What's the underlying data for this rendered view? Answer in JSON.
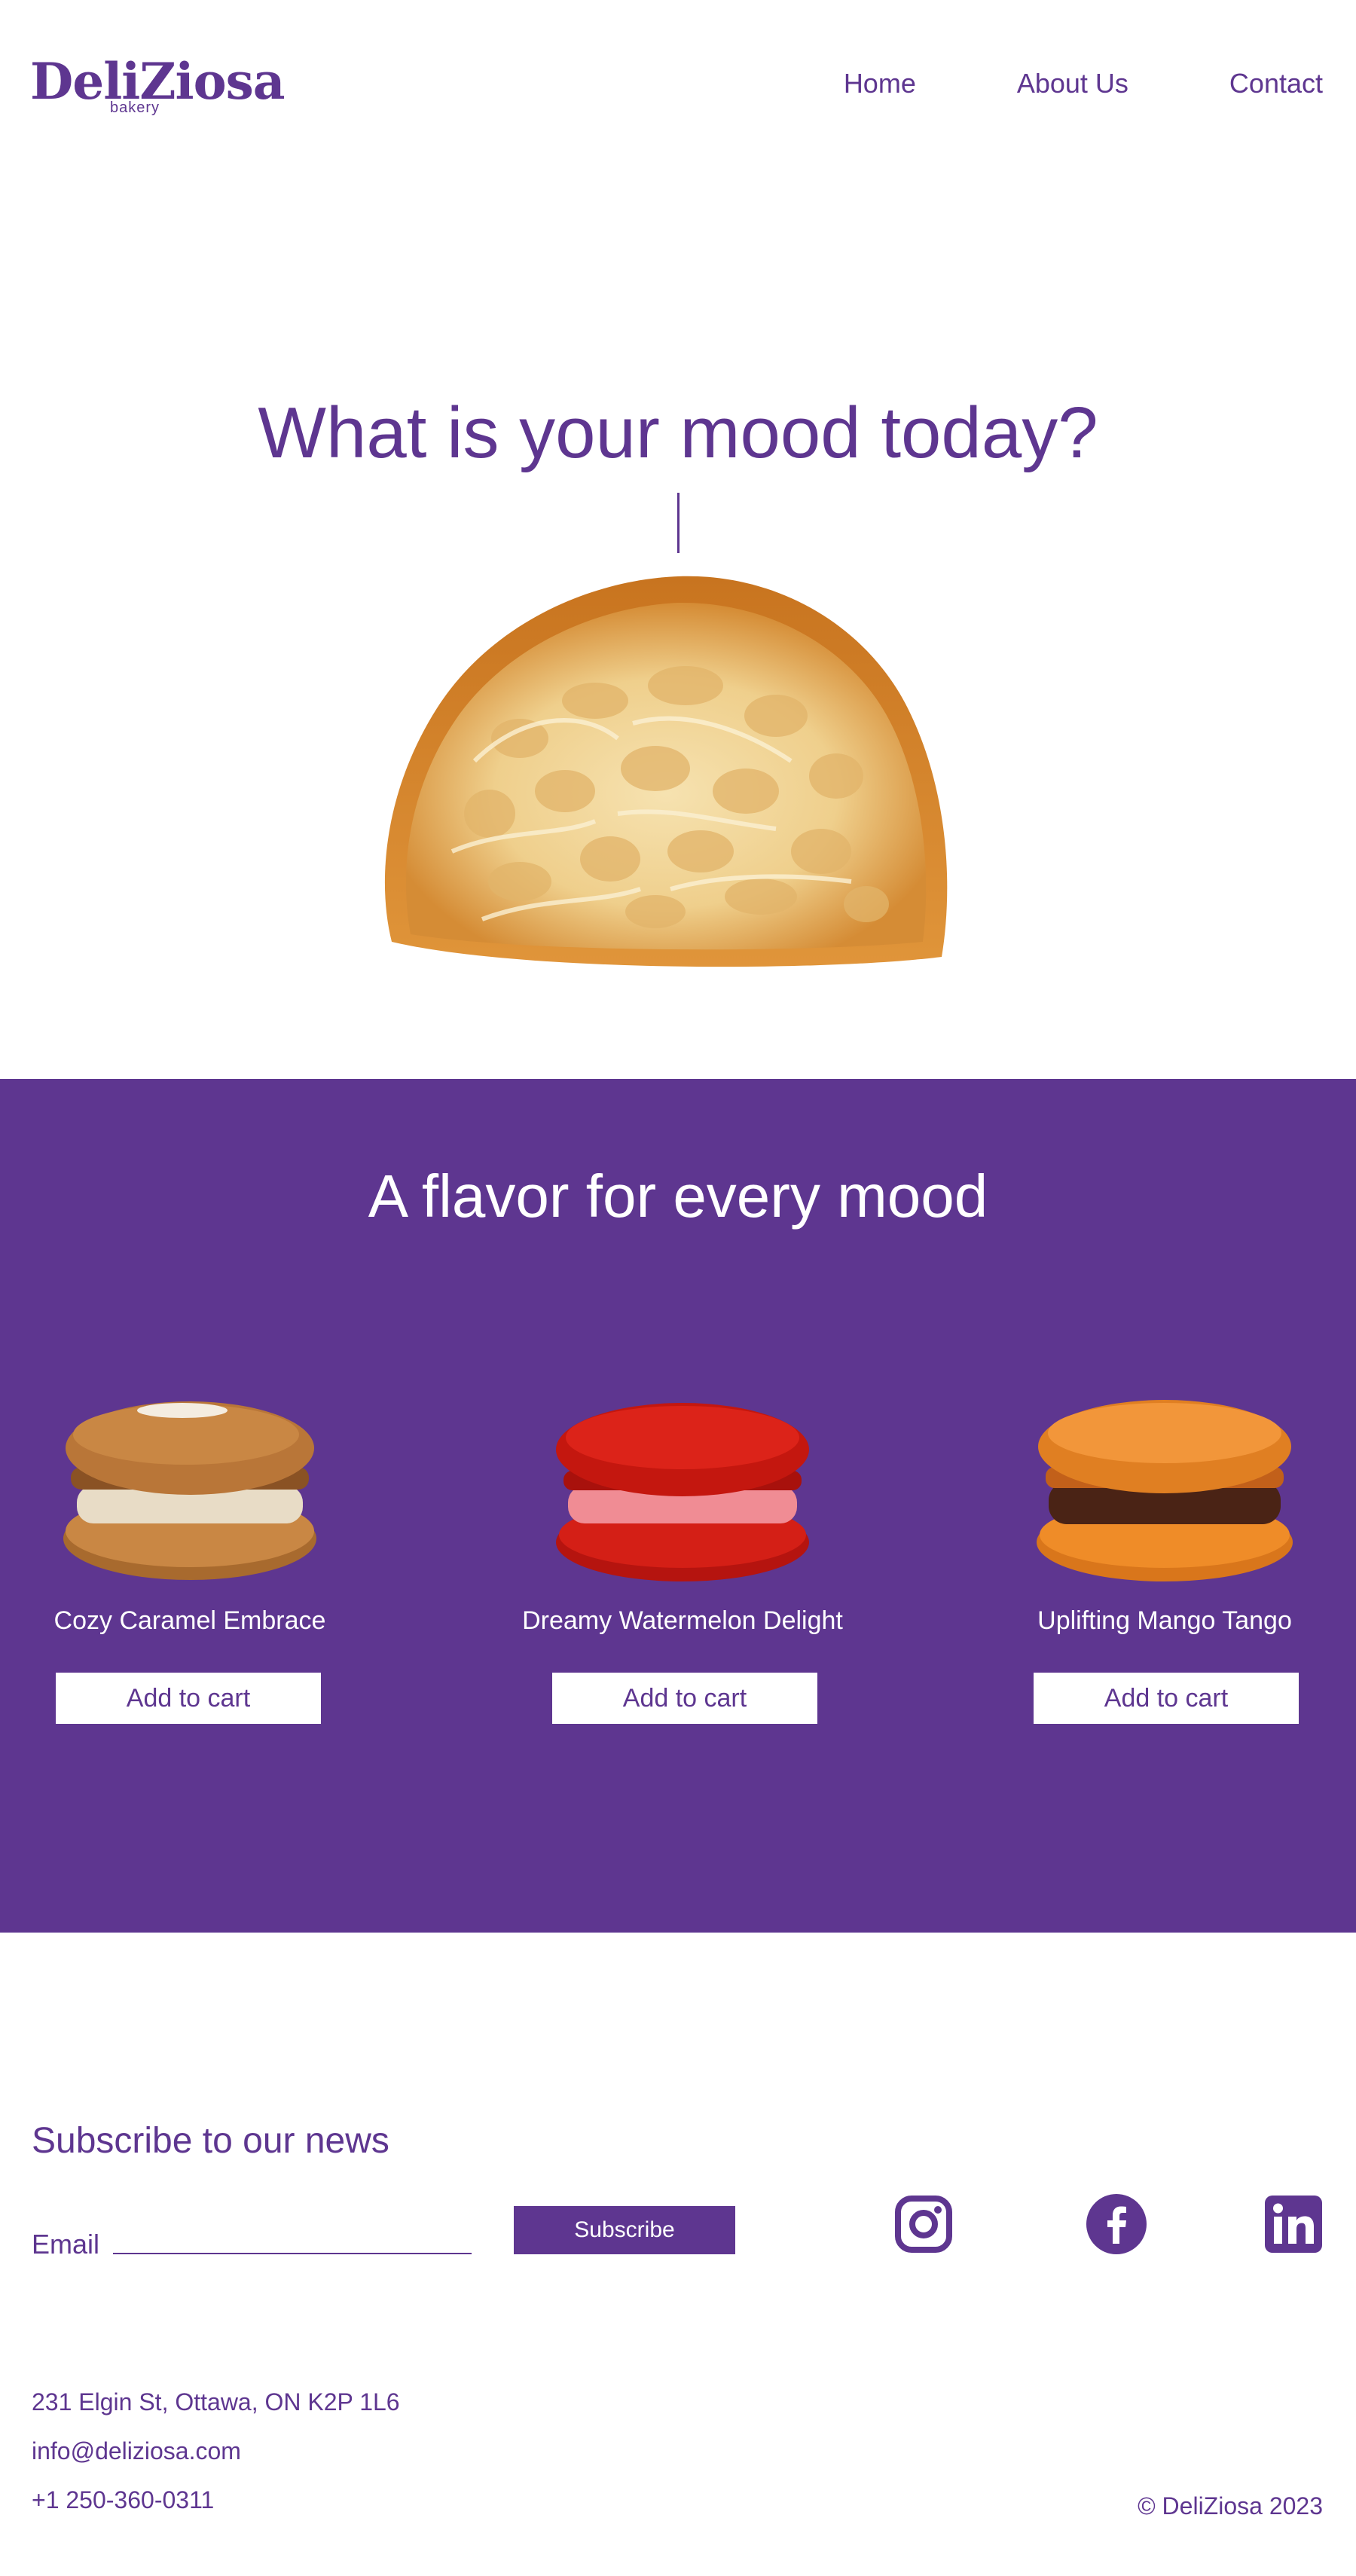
{
  "brand": {
    "name": "DeliZiosa",
    "sub": "bakery",
    "color": "#5e3690"
  },
  "nav": {
    "home": "Home",
    "about": "About Us",
    "contact": "Contact"
  },
  "hero": {
    "title": "What is your mood today?"
  },
  "flavors": {
    "title": "A flavor for every mood",
    "background": "#5e3690",
    "products": [
      {
        "name": "Cozy Caramel Embrace",
        "cart_label": "Add to cart"
      },
      {
        "name": "Dreamy Watermelon Delight",
        "cart_label": "Add to cart"
      },
      {
        "name": "Uplifting Mango Tango",
        "cart_label": "Add to cart"
      }
    ]
  },
  "subscribe": {
    "title": "Subscribe to our news",
    "email_label": "Email",
    "button_label": "Subscribe"
  },
  "social": {
    "icons": [
      "instagram-icon",
      "facebook-icon",
      "linkedin-icon"
    ]
  },
  "contact": {
    "address": "231 Elgin St, Ottawa, ON K2P 1L6",
    "email": "info@deliziosa.com",
    "phone": "+1 250-360-0311"
  },
  "footer": {
    "copyright": "© DeliZiosa 2023"
  }
}
